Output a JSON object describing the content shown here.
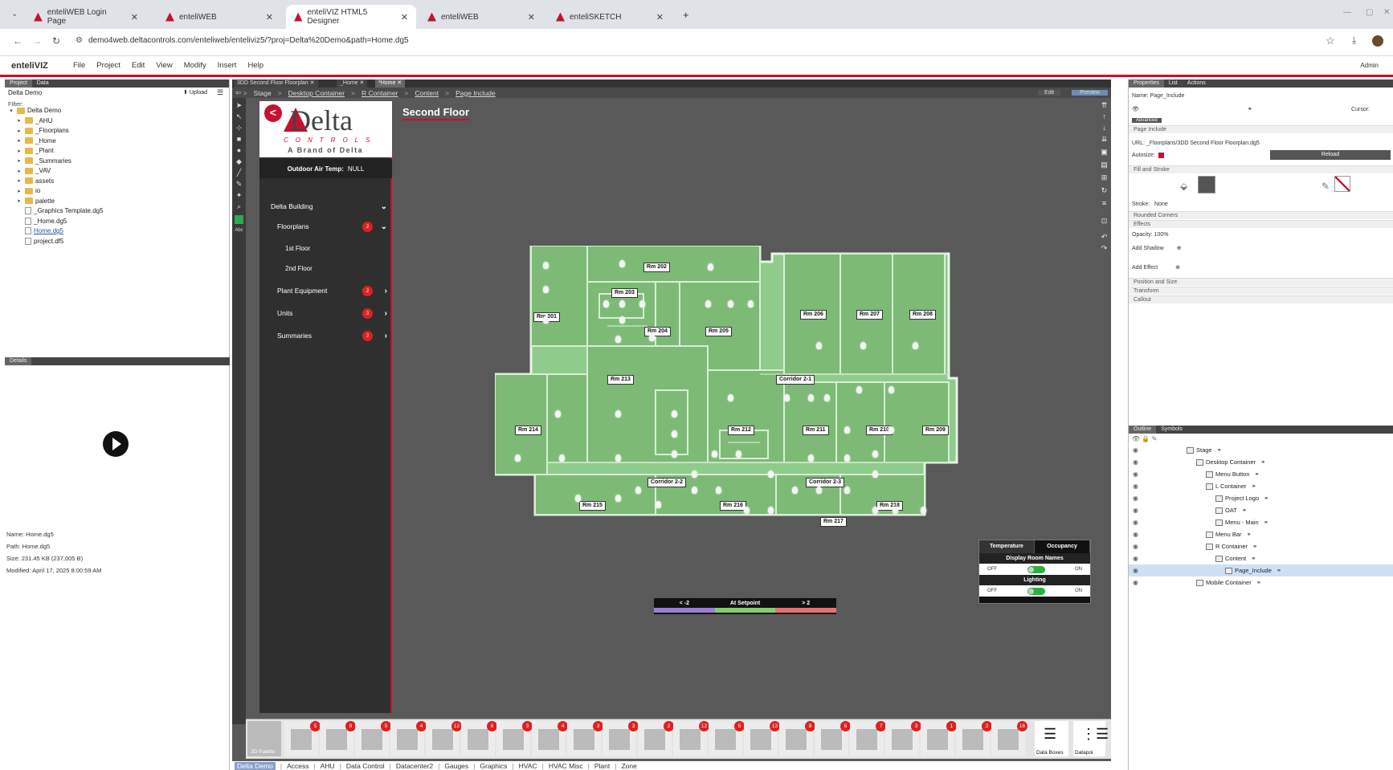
{
  "browser": {
    "tabs": [
      {
        "label": "enteliWEB Login Page",
        "active": false
      },
      {
        "label": "enteliWEB",
        "active": false
      },
      {
        "label": "enteliVIZ HTML5 Designer",
        "active": true
      },
      {
        "label": "enteliWEB",
        "active": false
      },
      {
        "label": "enteliSKETCH",
        "active": false
      }
    ],
    "url": "demo4web.deltacontrols.com/enteliweb/enteliviz5/?proj=Delta%20Demo&path=Home.dg5"
  },
  "app": {
    "logo": "enteliVIZ",
    "menu": [
      "File",
      "Project",
      "Edit",
      "View",
      "Modify",
      "Insert",
      "Help"
    ],
    "user": "Admin"
  },
  "left_panel": {
    "tabs": [
      "Project",
      "Data"
    ],
    "project_name": "Delta Demo",
    "upload_label": "Upload",
    "filter_label": "Filter:",
    "tree": [
      {
        "label": "Delta Demo",
        "type": "folder",
        "level": 0,
        "expanded": true
      },
      {
        "label": "_AHU",
        "type": "folder",
        "level": 1
      },
      {
        "label": "_Floorplans",
        "type": "folder",
        "level": 1
      },
      {
        "label": "_Home",
        "type": "folder",
        "level": 1
      },
      {
        "label": "_Plant",
        "type": "folder",
        "level": 1
      },
      {
        "label": "_Summaries",
        "type": "folder",
        "level": 1
      },
      {
        "label": "_VAV",
        "type": "folder",
        "level": 1
      },
      {
        "label": "assets",
        "type": "folder",
        "level": 1
      },
      {
        "label": "io",
        "type": "folder",
        "level": 1
      },
      {
        "label": "palette",
        "type": "folder",
        "level": 1
      },
      {
        "label": "_Graphics Template.dg5",
        "type": "file",
        "level": 1
      },
      {
        "label": "_Home.dg5",
        "type": "file",
        "level": 1
      },
      {
        "label": "Home.dg5",
        "type": "file",
        "level": 1,
        "selected": true
      },
      {
        "label": "project.df5",
        "type": "file",
        "level": 1
      }
    ],
    "details_tab": "Details",
    "details": [
      "Name: Home.dg5",
      "Path: Home.dg5",
      "Size: 231.45 KB (237,005 B)",
      "Modified: April 17, 2025 8:00:59 AM"
    ]
  },
  "canvas": {
    "doc_tabs": [
      {
        "label": "3DD Second Floor Floorplan",
        "active": false
      },
      {
        "label": "_Home",
        "active": false
      },
      {
        "label": "*Home",
        "active": true
      }
    ],
    "breadcrumbs": [
      "Stage",
      "Desktop Container",
      "R Container",
      "Content",
      "Page Include"
    ],
    "edit_label": "Edit",
    "preview_label": "Preview"
  },
  "delta_menu": {
    "back_icon": "<",
    "logo_text": "Delta",
    "logo_controls": "CONTROLS",
    "logo_brand": "A Brand of Delta",
    "oat_label": "Outdoor Air Temp:",
    "oat_value": "NULL",
    "items": [
      {
        "label": "Delta Building",
        "badge": "",
        "chevron": "down"
      },
      {
        "label": "Floorplans",
        "badge": "2",
        "chevron": "down"
      },
      {
        "label": "1st Floor",
        "sub": true
      },
      {
        "label": "2nd Floor",
        "sub": true
      },
      {
        "label": "Plant Equipment",
        "badge": "2",
        "chevron": "right"
      },
      {
        "label": "Units",
        "badge": "3",
        "chevron": "right"
      },
      {
        "label": "Summaries",
        "badge": "2",
        "chevron": "right"
      }
    ]
  },
  "floor": {
    "title": "Second Floor",
    "rooms": [
      "Rm 202",
      "Rm 203",
      "Rm 201",
      "Rm 204",
      "Rm 205",
      "Rm 206",
      "Rm 207",
      "Rm 208",
      "Rm 213",
      "Corridor 2-1",
      "Rm 214",
      "Rm 212",
      "Rm 211",
      "Rm 210",
      "Rm 209",
      "Corridor 2-2",
      "Corridor 2-3",
      "Rm 215",
      "Rm 216",
      "Rm 218",
      "Rm 217"
    ]
  },
  "setpoint_legend": {
    "labels": [
      "< -2",
      "At Setpoint",
      "> 2"
    ],
    "colors": [
      "#9a7fd8",
      "#7fcf6c",
      "#e87070"
    ]
  },
  "controls_panel": {
    "tabs": [
      "Temperature",
      "Occupancy"
    ],
    "display_names": "Display Room Names",
    "lighting": "Lighting",
    "off": "OFF",
    "on": "ON"
  },
  "palette": {
    "first_label": "2D Palette",
    "badges": [
      "5",
      "8",
      "5",
      "4",
      "12",
      "6",
      "3",
      "4",
      "3",
      "3",
      "2",
      "12",
      "5",
      "13",
      "8",
      "6",
      "7",
      "3",
      "1",
      "2",
      "16"
    ],
    "data_boxes_label": "Data Boxes",
    "datapoints_label": "Datapoi"
  },
  "bottom_tabs": [
    "Delta Demo",
    "Access",
    "AHU",
    "Data Control",
    "Datacenter2",
    "Gauges",
    "Graphics",
    "HVAC",
    "HVAC Misc",
    "Plant",
    "Zone"
  ],
  "right_panel": {
    "tabs": [
      "Properties",
      "List",
      "Actions"
    ],
    "name_label": "Name:",
    "name_value": "Page_Include",
    "cursor_label": "Cursor:",
    "advanced_label": "Advanced",
    "page_include_section": "Page Include",
    "url_label": "URL:",
    "url_value": "_Floorplans/3DD Second Floor Floorplan.dg5",
    "autosize_label": "Autosize:",
    "reload_label": "Reload",
    "fill_stroke_section": "Fill and Stroke",
    "stroke_label": "Stroke:",
    "stroke_value": "None",
    "rounded_corners": "Rounded Corners",
    "effects": "Effects",
    "opacity": "Opacity: 100%",
    "add_shadow": "Add Shadow",
    "add_effect": "Add Effect",
    "position_size": "Position and Size",
    "transform": "Transform",
    "callout": "Callout",
    "outline_tabs": [
      "Outline",
      "Symbols"
    ],
    "outline": [
      {
        "label": "Stage",
        "level": 0
      },
      {
        "label": "Desktop Container",
        "level": 1
      },
      {
        "label": "Menu Button",
        "level": 2
      },
      {
        "label": "L Container",
        "level": 2
      },
      {
        "label": "Project Logo",
        "level": 3
      },
      {
        "label": "OAT",
        "level": 3
      },
      {
        "label": "Menu - Main",
        "level": 3
      },
      {
        "label": "Menu Bar",
        "level": 2
      },
      {
        "label": "R Container",
        "level": 2
      },
      {
        "label": "Content",
        "level": 3
      },
      {
        "label": "Page_Include",
        "level": 4,
        "selected": true
      },
      {
        "label": "Mobile Container",
        "level": 1
      }
    ]
  }
}
